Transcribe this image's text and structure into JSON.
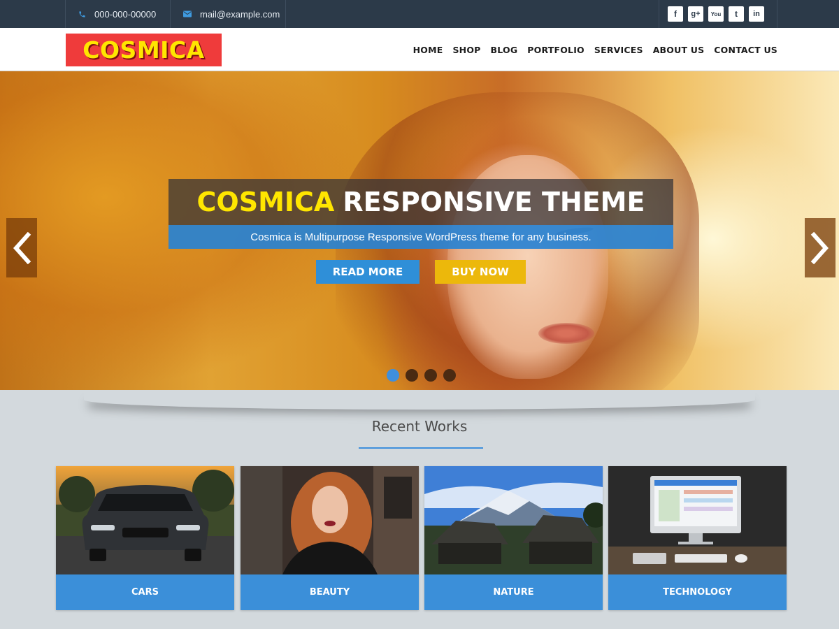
{
  "topbar": {
    "phone": "000-000-00000",
    "email": "mail@example.com",
    "social": [
      {
        "icon": "facebook-icon",
        "glyph": "f"
      },
      {
        "icon": "google-plus-icon",
        "glyph": "g+"
      },
      {
        "icon": "youtube-icon",
        "glyph": "You"
      },
      {
        "icon": "twitter-icon",
        "glyph": "t"
      },
      {
        "icon": "linkedin-icon",
        "glyph": "in"
      }
    ]
  },
  "header": {
    "logo": "COSMICA",
    "nav": [
      "HOME",
      "SHOP",
      "BLOG",
      "PORTFOLIO",
      "SERVICES",
      "ABOUT US",
      "CONTACT US"
    ]
  },
  "hero": {
    "title_highlight": "COSMICA",
    "title_rest": "RESPONSIVE THEME",
    "subtitle": "Cosmica is Multipurpose Responsive WordPress theme for any business.",
    "read_more": "READ MORE",
    "buy_now": "BUY NOW",
    "slides_total": 4,
    "active_slide": 1
  },
  "recent_works": {
    "title": "Recent Works",
    "items": [
      {
        "label": "CARS"
      },
      {
        "label": "BEAUTY"
      },
      {
        "label": "NATURE"
      },
      {
        "label": "TECHNOLOGY"
      }
    ]
  },
  "colors": {
    "topbar": "#2c3a49",
    "accent_blue": "#3b8fd9",
    "accent_yellow": "#ecb80b",
    "logo_bg": "#ef3b3b",
    "logo_text": "#ffe600"
  }
}
